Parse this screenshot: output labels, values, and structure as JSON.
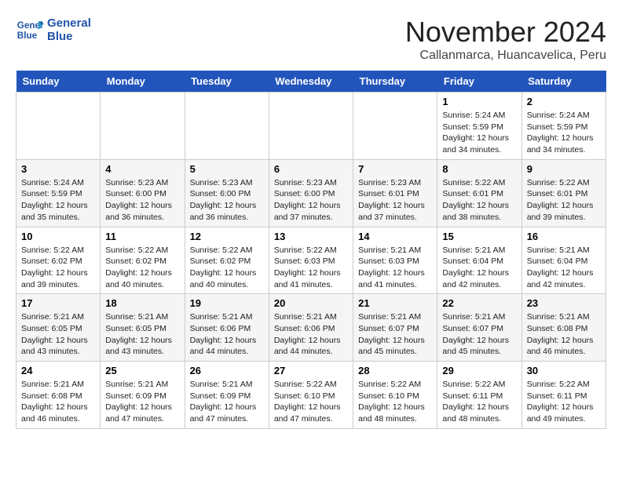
{
  "logo": {
    "line1": "General",
    "line2": "Blue"
  },
  "title": "November 2024",
  "location": "Callanmarca, Huancavelica, Peru",
  "headers": [
    "Sunday",
    "Monday",
    "Tuesday",
    "Wednesday",
    "Thursday",
    "Friday",
    "Saturday"
  ],
  "weeks": [
    [
      {
        "day": "",
        "text": ""
      },
      {
        "day": "",
        "text": ""
      },
      {
        "day": "",
        "text": ""
      },
      {
        "day": "",
        "text": ""
      },
      {
        "day": "",
        "text": ""
      },
      {
        "day": "1",
        "text": "Sunrise: 5:24 AM\nSunset: 5:59 PM\nDaylight: 12 hours\nand 34 minutes."
      },
      {
        "day": "2",
        "text": "Sunrise: 5:24 AM\nSunset: 5:59 PM\nDaylight: 12 hours\nand 34 minutes."
      }
    ],
    [
      {
        "day": "3",
        "text": "Sunrise: 5:24 AM\nSunset: 5:59 PM\nDaylight: 12 hours\nand 35 minutes."
      },
      {
        "day": "4",
        "text": "Sunrise: 5:23 AM\nSunset: 6:00 PM\nDaylight: 12 hours\nand 36 minutes."
      },
      {
        "day": "5",
        "text": "Sunrise: 5:23 AM\nSunset: 6:00 PM\nDaylight: 12 hours\nand 36 minutes."
      },
      {
        "day": "6",
        "text": "Sunrise: 5:23 AM\nSunset: 6:00 PM\nDaylight: 12 hours\nand 37 minutes."
      },
      {
        "day": "7",
        "text": "Sunrise: 5:23 AM\nSunset: 6:01 PM\nDaylight: 12 hours\nand 37 minutes."
      },
      {
        "day": "8",
        "text": "Sunrise: 5:22 AM\nSunset: 6:01 PM\nDaylight: 12 hours\nand 38 minutes."
      },
      {
        "day": "9",
        "text": "Sunrise: 5:22 AM\nSunset: 6:01 PM\nDaylight: 12 hours\nand 39 minutes."
      }
    ],
    [
      {
        "day": "10",
        "text": "Sunrise: 5:22 AM\nSunset: 6:02 PM\nDaylight: 12 hours\nand 39 minutes."
      },
      {
        "day": "11",
        "text": "Sunrise: 5:22 AM\nSunset: 6:02 PM\nDaylight: 12 hours\nand 40 minutes."
      },
      {
        "day": "12",
        "text": "Sunrise: 5:22 AM\nSunset: 6:02 PM\nDaylight: 12 hours\nand 40 minutes."
      },
      {
        "day": "13",
        "text": "Sunrise: 5:22 AM\nSunset: 6:03 PM\nDaylight: 12 hours\nand 41 minutes."
      },
      {
        "day": "14",
        "text": "Sunrise: 5:21 AM\nSunset: 6:03 PM\nDaylight: 12 hours\nand 41 minutes."
      },
      {
        "day": "15",
        "text": "Sunrise: 5:21 AM\nSunset: 6:04 PM\nDaylight: 12 hours\nand 42 minutes."
      },
      {
        "day": "16",
        "text": "Sunrise: 5:21 AM\nSunset: 6:04 PM\nDaylight: 12 hours\nand 42 minutes."
      }
    ],
    [
      {
        "day": "17",
        "text": "Sunrise: 5:21 AM\nSunset: 6:05 PM\nDaylight: 12 hours\nand 43 minutes."
      },
      {
        "day": "18",
        "text": "Sunrise: 5:21 AM\nSunset: 6:05 PM\nDaylight: 12 hours\nand 43 minutes."
      },
      {
        "day": "19",
        "text": "Sunrise: 5:21 AM\nSunset: 6:06 PM\nDaylight: 12 hours\nand 44 minutes."
      },
      {
        "day": "20",
        "text": "Sunrise: 5:21 AM\nSunset: 6:06 PM\nDaylight: 12 hours\nand 44 minutes."
      },
      {
        "day": "21",
        "text": "Sunrise: 5:21 AM\nSunset: 6:07 PM\nDaylight: 12 hours\nand 45 minutes."
      },
      {
        "day": "22",
        "text": "Sunrise: 5:21 AM\nSunset: 6:07 PM\nDaylight: 12 hours\nand 45 minutes."
      },
      {
        "day": "23",
        "text": "Sunrise: 5:21 AM\nSunset: 6:08 PM\nDaylight: 12 hours\nand 46 minutes."
      }
    ],
    [
      {
        "day": "24",
        "text": "Sunrise: 5:21 AM\nSunset: 6:08 PM\nDaylight: 12 hours\nand 46 minutes."
      },
      {
        "day": "25",
        "text": "Sunrise: 5:21 AM\nSunset: 6:09 PM\nDaylight: 12 hours\nand 47 minutes."
      },
      {
        "day": "26",
        "text": "Sunrise: 5:21 AM\nSunset: 6:09 PM\nDaylight: 12 hours\nand 47 minutes."
      },
      {
        "day": "27",
        "text": "Sunrise: 5:22 AM\nSunset: 6:10 PM\nDaylight: 12 hours\nand 47 minutes."
      },
      {
        "day": "28",
        "text": "Sunrise: 5:22 AM\nSunset: 6:10 PM\nDaylight: 12 hours\nand 48 minutes."
      },
      {
        "day": "29",
        "text": "Sunrise: 5:22 AM\nSunset: 6:11 PM\nDaylight: 12 hours\nand 48 minutes."
      },
      {
        "day": "30",
        "text": "Sunrise: 5:22 AM\nSunset: 6:11 PM\nDaylight: 12 hours\nand 49 minutes."
      }
    ]
  ]
}
